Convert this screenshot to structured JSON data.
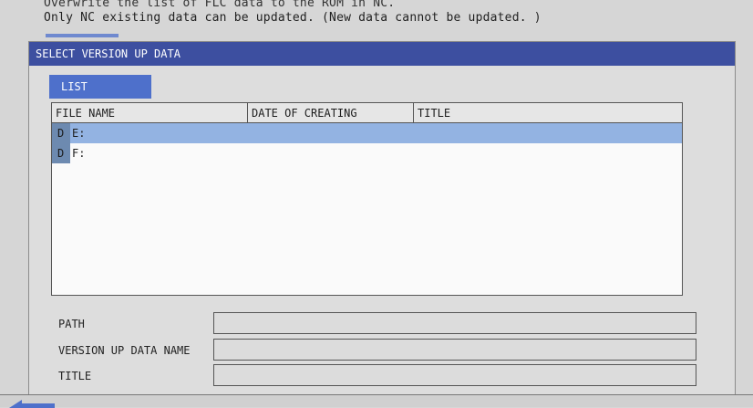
{
  "message": {
    "line1": "Overwrite the list of FLC data to the ROM in NC.",
    "line2": "Only NC existing data can be updated. (New data cannot be updated. )"
  },
  "window": {
    "title": "SELECT VERSION UP DATA"
  },
  "tabs": [
    {
      "label": "LIST",
      "active": true
    }
  ],
  "list": {
    "columns": [
      "FILE NAME",
      "DATE OF CREATING",
      "TITLE"
    ],
    "rows": [
      {
        "type": "D",
        "name": "E:",
        "date": "",
        "title": "",
        "selected": true
      },
      {
        "type": "D",
        "name": "F:",
        "date": "",
        "title": "",
        "selected": false
      }
    ]
  },
  "fields": {
    "path_label": "PATH",
    "path_value": "",
    "version_up_name_label": "VERSION UP DATA NAME",
    "version_up_name_value": "",
    "title_label": "TITLE",
    "title_value": ""
  },
  "colors": {
    "title_bar": "#3d4fa0",
    "tab_active": "#4e70cb",
    "selected_row": "#93b3e2",
    "type_badge": "#6d8ab0",
    "back_arrow": "#4e70cb"
  },
  "icons": {
    "back": "back-arrow-icon"
  }
}
